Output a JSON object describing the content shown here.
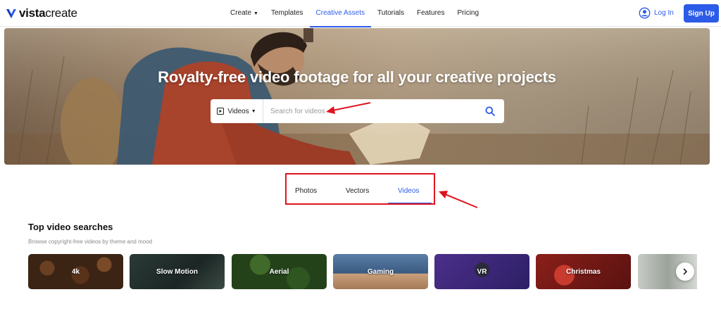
{
  "brand": {
    "bold": "vista",
    "light": "create"
  },
  "nav": {
    "links": [
      {
        "label": "Create",
        "has_caret": true
      },
      {
        "label": "Templates"
      },
      {
        "label": "Creative Assets",
        "active": true
      },
      {
        "label": "Tutorials"
      },
      {
        "label": "Features"
      },
      {
        "label": "Pricing"
      }
    ],
    "login_label": "Log In",
    "signup_label": "Sign Up"
  },
  "hero": {
    "title": "Royalty-free video footage for all your creative projects",
    "search": {
      "type_label": "Videos",
      "placeholder": "Search for videos"
    }
  },
  "tabs": [
    {
      "label": "Photos"
    },
    {
      "label": "Vectors"
    },
    {
      "label": "Videos",
      "active": true
    }
  ],
  "top_searches": {
    "title": "Top video searches",
    "subtitle": "Browse copyright-free videos by theme and mood",
    "cards": [
      {
        "label": "4k"
      },
      {
        "label": "Slow Motion"
      },
      {
        "label": "Aerial"
      },
      {
        "label": "Gaming"
      },
      {
        "label": "VR"
      },
      {
        "label": "Christmas"
      },
      {
        "label": ""
      }
    ]
  },
  "colors": {
    "accent": "#2c5be8",
    "annotation": "#e0141e"
  },
  "icons": {
    "logo": "vistacreate-logo-icon",
    "login": "user-circle-icon",
    "search_type": "video-play-icon",
    "search": "search-icon",
    "next": "chevron-right-icon"
  }
}
